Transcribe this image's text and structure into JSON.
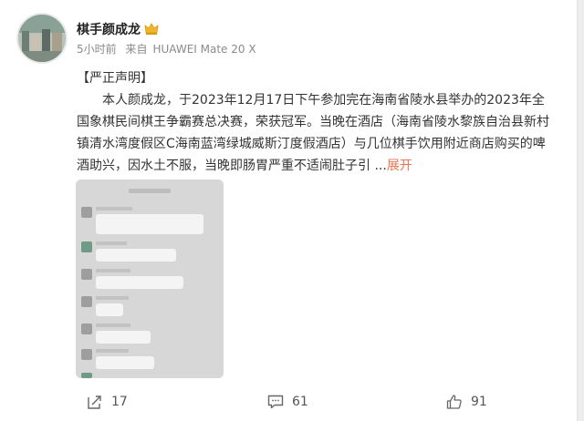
{
  "post": {
    "author": "棋手颜成龙",
    "time": "5小时前",
    "source_prefix": "来自",
    "device": "HUAWEI Mate 20 X",
    "heading": "【严正声明】",
    "paragraph": "本人颜成龙，于2023年12月17日下午参加完在海南省陵水县举办的2023年全国象棋民间棋王争霸赛总决赛，荣获冠军。当晚在酒店（海南省陵水黎族自治县新村镇清水湾度假区C海南蓝湾绿城威斯汀度假酒店）与几位棋手饮用附近商店购买的啤酒助兴，因水土不服，当晚即肠胃严重不适闹肚子引 ...",
    "expand_label": "展开"
  },
  "actions": {
    "repost_count": "17",
    "comment_count": "61",
    "like_count": "91"
  },
  "colors": {
    "accent": "#eb7350",
    "meta_gray": "#8a8a8a",
    "crown_gold": "#f2b62c"
  },
  "icons": [
    "crown-icon",
    "repost-icon",
    "comment-icon",
    "like-icon"
  ]
}
